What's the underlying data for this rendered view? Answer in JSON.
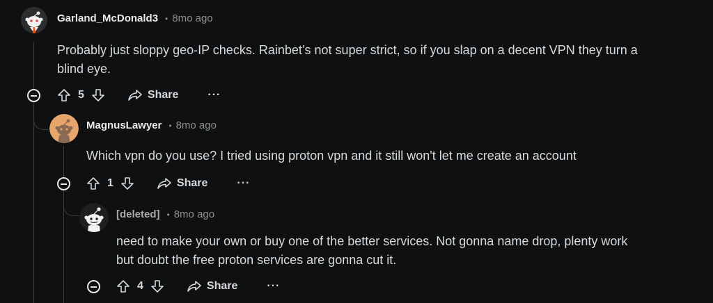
{
  "comments": [
    {
      "username": "Garland_McDonald3",
      "separator": "•",
      "time": "8mo ago",
      "body_lines": [
        "Probably just sloppy geo-IP checks. Rainbet’s not super strict, so if you slap on a decent VPN they turn a",
        "blind eye."
      ],
      "votes": "5",
      "share_label": "Share",
      "more_label": "···"
    },
    {
      "username": "MagnusLawyer",
      "separator": "•",
      "time": "8mo ago",
      "body_lines": [
        "Which vpn do you use? I tried using proton vpn and it still won't let me create an account"
      ],
      "votes": "1",
      "share_label": "Share",
      "more_label": "···"
    },
    {
      "username": "[deleted]",
      "separator": "•",
      "time": "8mo ago",
      "body_lines": [
        "need to make your own or buy one of the better services. Not gonna name drop, plenty work",
        "but doubt the free proton services are gonna cut it."
      ],
      "votes": "4",
      "share_label": "Share",
      "more_label": "···"
    }
  ],
  "colors": {
    "background": "#0f1011",
    "thread_line": "#3a3c3e",
    "text": "#d7dadc",
    "muted": "#8c8f91",
    "avatar_orange": "#e8a56a"
  }
}
